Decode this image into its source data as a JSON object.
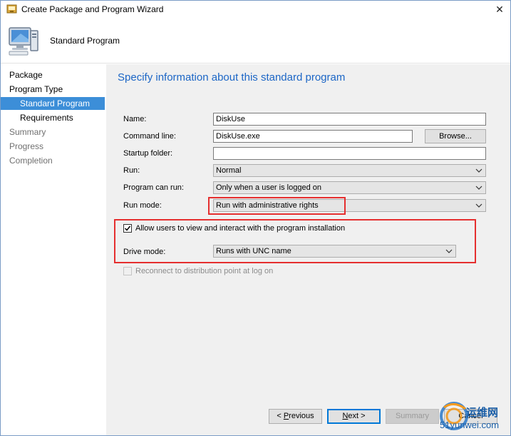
{
  "window": {
    "title": "Create Package and Program Wizard",
    "close_glyph": "✕"
  },
  "header": {
    "title": "Standard Program"
  },
  "nav": {
    "items": [
      {
        "label": "Package"
      },
      {
        "label": "Program Type"
      },
      {
        "label": "Standard Program"
      },
      {
        "label": "Requirements"
      },
      {
        "label": "Summary"
      },
      {
        "label": "Progress"
      },
      {
        "label": "Completion"
      }
    ]
  },
  "main": {
    "heading": "Specify information about this standard program",
    "name_label": "Name:",
    "name_value": "DiskUse",
    "command_label": "Command line:",
    "command_value": "DiskUse.exe",
    "browse_label": "Browse...",
    "startup_label": "Startup folder:",
    "startup_value": "",
    "run_label": "Run:",
    "run_value": "Normal",
    "can_run_label": "Program can run:",
    "can_run_value": "Only when a user is logged on",
    "run_mode_label": "Run mode:",
    "run_mode_value": "Run with administrative rights",
    "allow_interact_label": "Allow users to view and interact with the program installation",
    "allow_interact_checked": true,
    "drive_mode_label": "Drive mode:",
    "drive_mode_value": "Runs with UNC name",
    "reconnect_label": "Reconnect to distribution point at log on",
    "reconnect_checked": false
  },
  "footer": {
    "previous_prefix": "< ",
    "previous_hotkey": "P",
    "previous_rest": "revious",
    "next_hotkey": "N",
    "next_rest": "ext >",
    "summary_label": "Summary",
    "cancel_label": "Cancel"
  },
  "watermark": {
    "line1": "运维网",
    "line2": "51yunwei.com"
  },
  "colors": {
    "accent": "#3c8ed8",
    "heading": "#1c66c6",
    "highlight_box": "#e52f2f"
  }
}
